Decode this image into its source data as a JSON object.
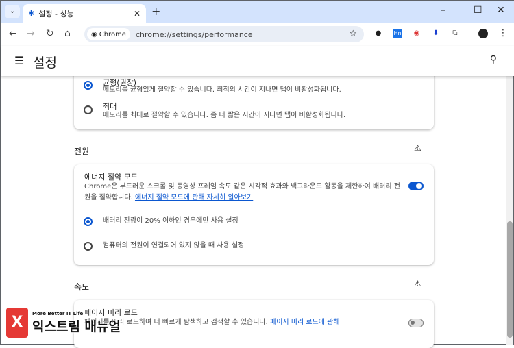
{
  "browser": {
    "tab_title": "설정 - 성능",
    "chip_label": "Chrome",
    "url": "chrome://settings/performance"
  },
  "header": {
    "title": "설정"
  },
  "memory": {
    "options": [
      {
        "label": "균형(권장)",
        "desc": "메모리를 균형있게 절약할 수 있습니다. 최적의 시간이 지나면 탭이 비활성화됩니다.",
        "selected": true
      },
      {
        "label": "최대",
        "desc": "메모리를 최대로 절약할 수 있습니다. 좀 더 짧은 시간이 지나면 탭이 비활성화됩니다.",
        "selected": false
      }
    ]
  },
  "power": {
    "heading": "전원",
    "title": "에너지 절약 모드",
    "desc": "Chrome은 부드러운 스크롤 및 동영상 프레임 속도 같은 시각적 효과와 백그라운드 활동을 제한하여 배터리 전원을 절약합니다.",
    "link": "에너지 절약 모드에 관해 자세히 알아보기",
    "enabled": true,
    "options": [
      {
        "label": "배터리 잔량이 20% 이하인 경우에만 사용 설정",
        "selected": true
      },
      {
        "label": "컴퓨터의 전원이 연결되어 있지 않을 때 사용 설정",
        "selected": false
      }
    ]
  },
  "speed": {
    "heading": "속도",
    "title": "페이지 미리 로드",
    "desc": "페이지를 미리 로드하여 더 빠르게 탐색하고 검색할 수 있습니다.",
    "link": "페이지 미리 로드에 관해",
    "enabled": false
  },
  "watermark": {
    "tagline": "More Better IT Life",
    "brand": "익스트림 매뉴얼"
  }
}
